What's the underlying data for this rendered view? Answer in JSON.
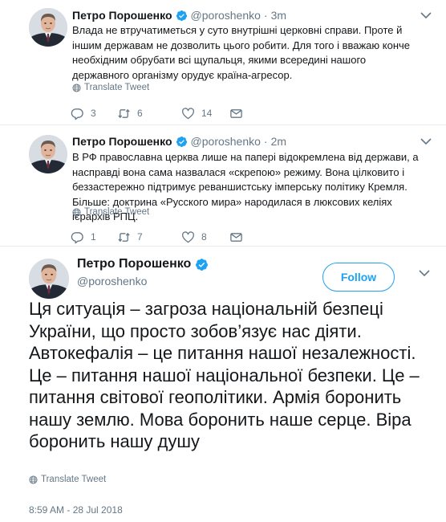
{
  "colors": {
    "accent": "#1da1f2",
    "muted": "#657786",
    "text": "#14171a",
    "divider": "#e6ecf0"
  },
  "icons": {
    "verified": "verified-badge-icon",
    "caret": "chevron-down-icon",
    "globe": "globe-icon",
    "reply": "reply-icon",
    "retweet": "retweet-icon",
    "like": "heart-icon",
    "message": "direct-message-icon"
  },
  "tweets": [
    {
      "name": "Петро Порошенко",
      "handle": "@poroshenko",
      "time": "3m",
      "text": "Влада не втручатиметься у суто внутрішні церковні справи. Проте й іншим державам не дозволить цього робити. Для того і вважаю конче необхідним обрубати всі щупальця, якими всередині нашого державного організму орудує країна-агресор.",
      "translate": "Translate Tweet",
      "replies": "3",
      "retweets": "6",
      "likes": "14"
    },
    {
      "name": "Петро Порошенко",
      "handle": "@poroshenko",
      "time": "2m",
      "text": "В РФ православна церква лише на папері відокремлена від держави, а насправді вона сама назвалася «скрепою» режиму. Вона цілковито і беззастережно підтримує реваншистську імперську політику Кремля. Більше: доктрина «Русского мира» народилася в люксових келіях ієрархів РПЦ.",
      "translate": "Translate Tweet",
      "replies": "1",
      "retweets": "7",
      "likes": "8"
    }
  ],
  "main": {
    "name": "Петро Порошенко",
    "handle": "@poroshenko",
    "follow": "Follow",
    "text": "Ця ситуація – загроза національній безпеці України, що просто зобов’язує нас діяти. Автокефалія – це питання нашої незалежності. Це – питання нашої національної безпеки. Це – питання світової геополітики. Армія боронить нашу землю. Мова боронить наше серце. Віра боронить нашу душу",
    "translate": "Translate Tweet",
    "timestamp": "8:59 AM - 28 Jul 2018"
  }
}
